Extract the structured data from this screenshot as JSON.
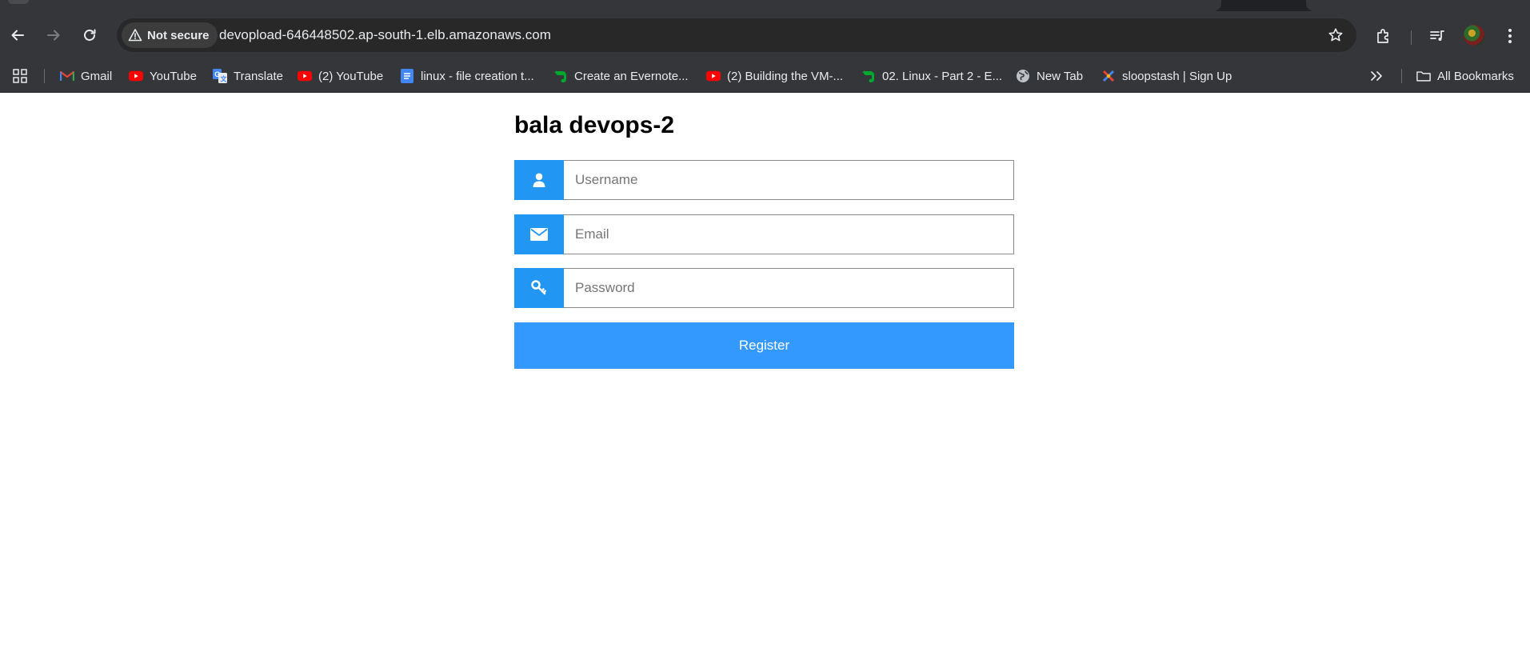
{
  "browser": {
    "security_label": "Not secure",
    "url": "devopload-646448502.ap-south-1.elb.amazonaws.com",
    "bookmarks": [
      {
        "label": "Gmail",
        "icon": "gmail-icon"
      },
      {
        "label": "YouTube",
        "icon": "youtube-icon"
      },
      {
        "label": "Translate",
        "icon": "translate-icon"
      },
      {
        "label": "(2) YouTube",
        "icon": "youtube-icon"
      },
      {
        "label": "linux - file creation t...",
        "icon": "docs-icon"
      },
      {
        "label": "Create an Evernote...",
        "icon": "evernote-icon"
      },
      {
        "label": "(2) Building the VM-...",
        "icon": "youtube-icon"
      },
      {
        "label": "02. Linux - Part 2 - E...",
        "icon": "evernote-icon"
      },
      {
        "label": "New Tab",
        "icon": "globe-icon"
      },
      {
        "label": "sloopstash | Sign Up",
        "icon": "sloopstash-icon"
      }
    ],
    "all_bookmarks_label": "All Bookmarks"
  },
  "page": {
    "title": "bala devops-2",
    "username_placeholder": "Username",
    "email_placeholder": "Email",
    "password_placeholder": "Password",
    "register_label": "Register"
  },
  "colors": {
    "accent": "#2196f3",
    "button": "#3399ff",
    "chrome_toolbar": "#35363a",
    "omnibox": "#282828"
  }
}
